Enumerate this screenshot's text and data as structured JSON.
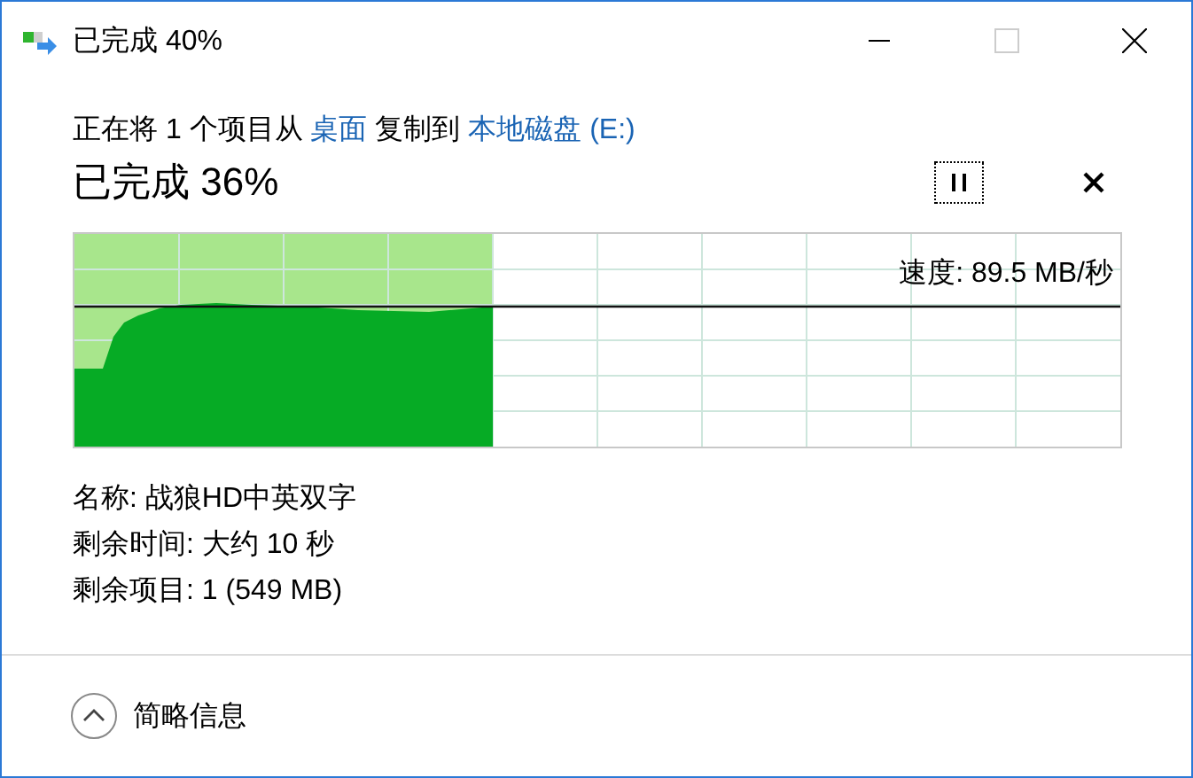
{
  "window": {
    "title": "已完成 40%"
  },
  "title_buttons": [
    {
      "kind": "minimize",
      "disabled": false
    },
    {
      "kind": "maximize",
      "disabled": true
    },
    {
      "kind": "close",
      "disabled": false
    }
  ],
  "description": [
    {
      "kind": "text",
      "text": "正在将 1 个项目从 "
    },
    {
      "kind": "link",
      "text": "桌面"
    },
    {
      "kind": "text",
      "text": " 复制到 "
    },
    {
      "kind": "link",
      "text": "本地磁盘 (E:)"
    }
  ],
  "status": "已完成 36%",
  "progress": {
    "level": 0.4,
    "speed": "速度: 89.5 MB/秒"
  },
  "details": [
    "名称: 战狼HD中英双字",
    "剩余时间: 大约 10 秒",
    "剩余项目: 1 (549 MB)"
  ],
  "footer": {
    "label": "简略信息"
  }
}
